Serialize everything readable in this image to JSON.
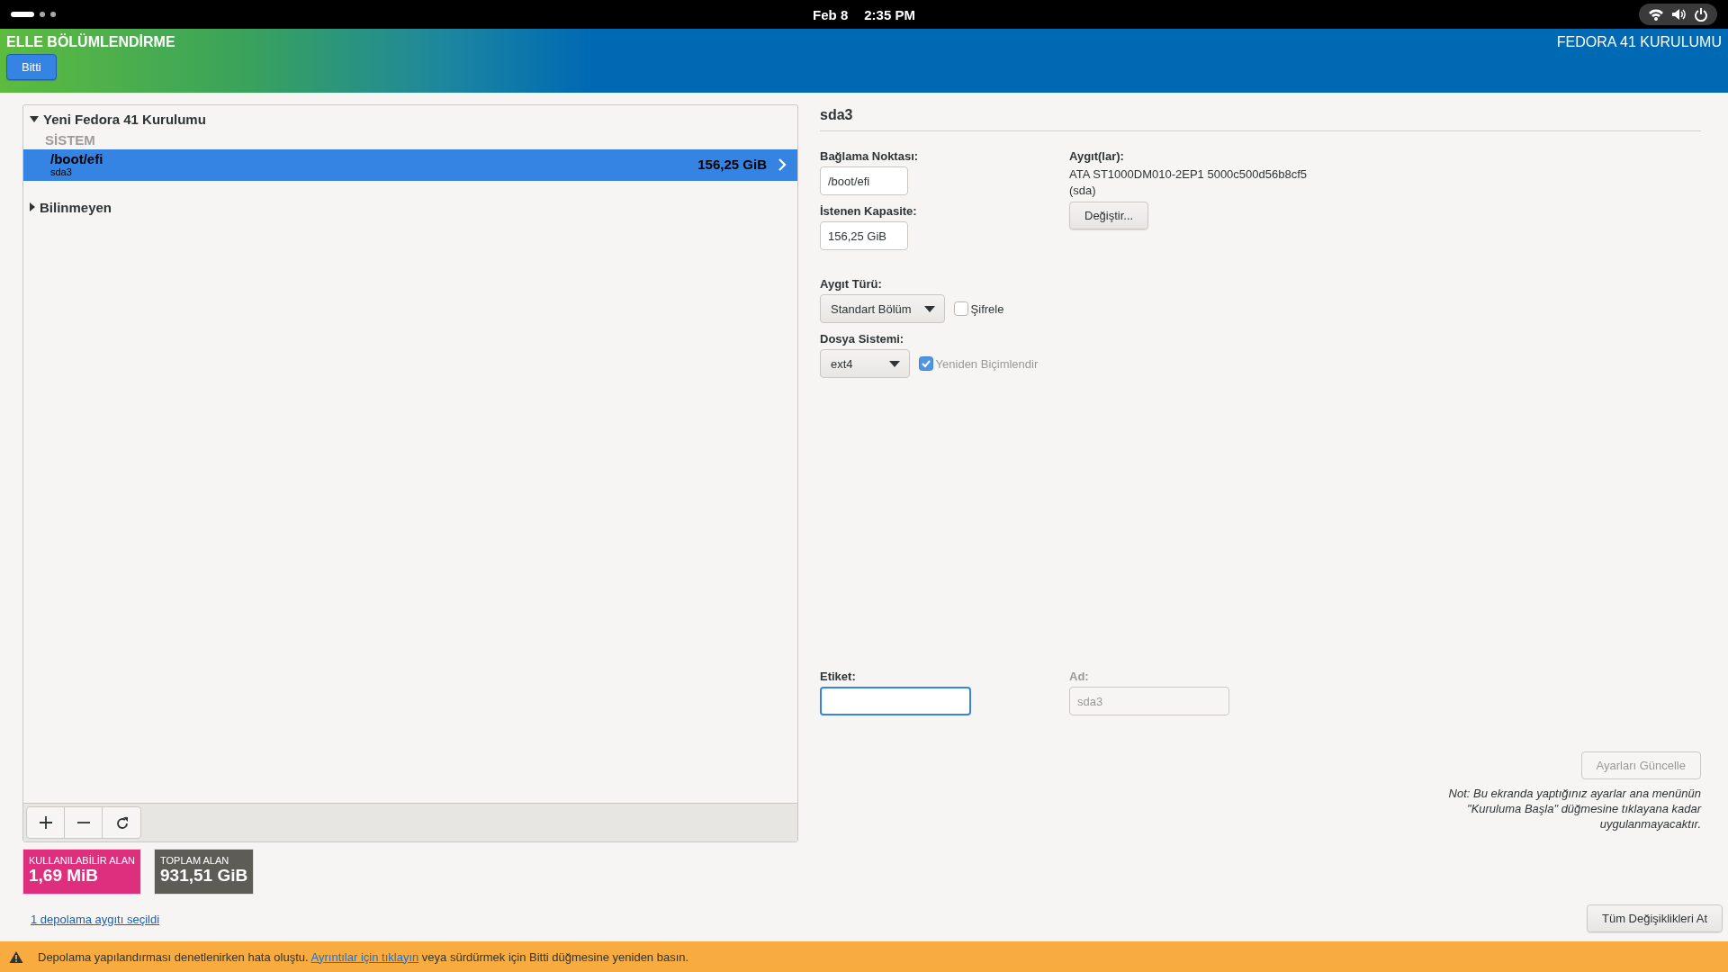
{
  "top_bar": {
    "date": "Feb 8",
    "time": "2:35 PM"
  },
  "header": {
    "title": "ELLE BÖLÜMLENDİRME",
    "done_button": "Bitti",
    "product": "FEDORA 41 KURULUMU"
  },
  "tree": [
    {
      "label": "Yeni Fedora 41 Kurulumu",
      "expanded": true,
      "sections": [
        {
          "title": "SİSTEM",
          "items": [
            {
              "mount": "/boot/efi",
              "device": "sda3",
              "size": "156,25 GiB",
              "selected": true
            }
          ]
        }
      ]
    },
    {
      "label": "Bilinmeyen",
      "expanded": false
    }
  ],
  "space": [
    {
      "label": "KULLANILABİLİR ALAN",
      "value": "1,69 MiB",
      "color": "#dd2f7d"
    },
    {
      "label": "TOPLAM ALAN",
      "value": "931,51 GiB",
      "color": "#5e5c57"
    }
  ],
  "storage_link": "1 depolama aygıtı seçildi",
  "detail": {
    "title": "sda3",
    "mount_point": {
      "label": "Bağlama Noktası:",
      "value": "/boot/efi"
    },
    "capacity": {
      "label": "İstenen Kapasite:",
      "value": "156,25 GiB"
    },
    "devices": {
      "label": "Aygıt(lar):",
      "text": "ATA ST1000DM010-2EP1 5000c500d56b8cf5",
      "sub": "(sda)",
      "button": "Değiştir..."
    },
    "device_type": {
      "label": "Aygıt Türü:",
      "value": "Standart Bölüm"
    },
    "encrypt": {
      "label": "Şifrele",
      "checked": false
    },
    "file_system": {
      "label": "Dosya Sistemi:",
      "value": "ext4"
    },
    "reformat": {
      "label": "Yeniden Biçimlendir",
      "checked": true,
      "disabled": true
    },
    "tag": {
      "label": "Etiket:",
      "focused": true
    },
    "name": {
      "label": "Ad:",
      "value": "sda3",
      "disabled": true
    },
    "update_button": {
      "label": "Ayarları Güncelle",
      "disabled": true
    },
    "note": "Not:  Bu ekranda yaptığınız ayarlar ana menünün \"Kuruluma Başla\" düğmesine tıklayana kadar uygulanmayacaktır.",
    "discard_button": "Tüm Değişiklikleri At"
  },
  "notification": {
    "before": "Depolama yapılandırması denetlenirken hata oluştu.",
    "link": "Ayrıntılar için tıklayın",
    "after": "veya sürdürmek için Bitti düğmesine yeniden basın."
  }
}
